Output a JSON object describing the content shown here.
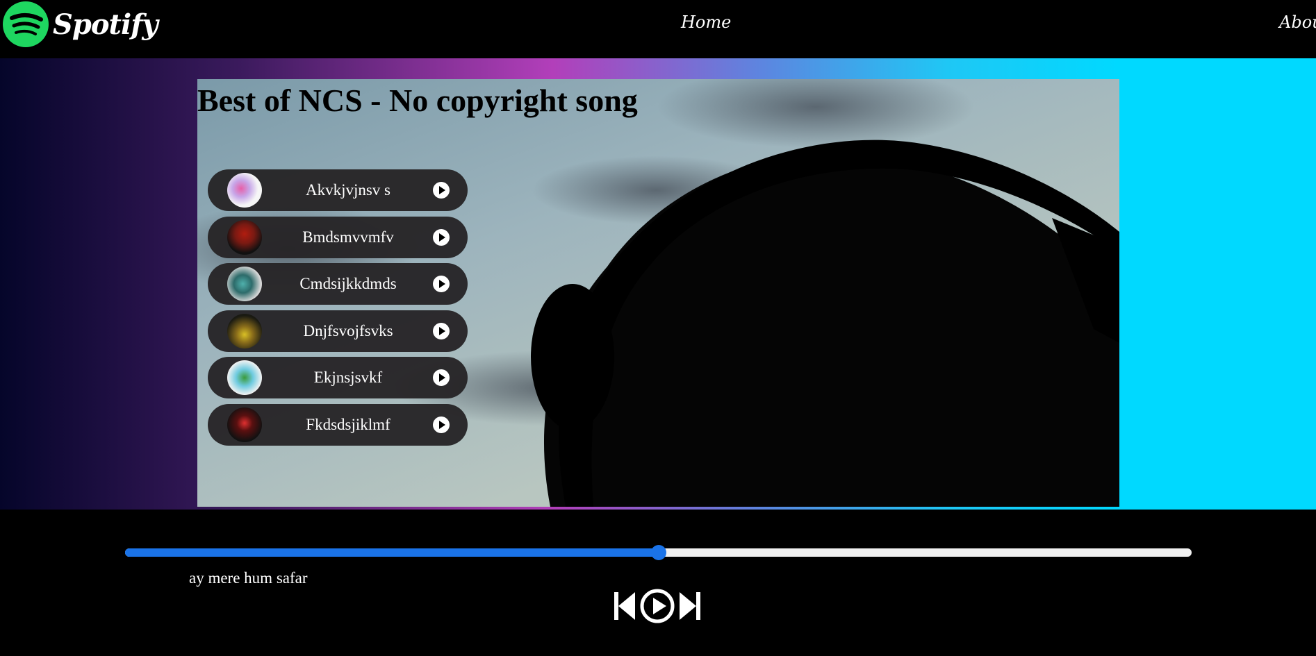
{
  "nav": {
    "brand": "Spotify",
    "links": [
      "Home",
      "About"
    ]
  },
  "playlist": {
    "title": "Best of NCS - No copyright song",
    "songs": [
      {
        "name": "Akvkjvjnsv s"
      },
      {
        "name": "Bmdsmvvmfv"
      },
      {
        "name": "Cmdsijkkdmds"
      },
      {
        "name": "Dnjfsvojfsvks"
      },
      {
        "name": "Ekjnsjsvkf"
      },
      {
        "name": "Fkdsdsjiklmf"
      }
    ]
  },
  "player": {
    "current_song": "ay mere hum safar",
    "progress_fraction": 0.5,
    "controls": [
      "previous-icon",
      "play-circle-icon",
      "next-icon"
    ]
  },
  "colors": {
    "brand_green": "#1ed760",
    "progress_blue": "#1a73e8",
    "song_pill": "#262426"
  }
}
